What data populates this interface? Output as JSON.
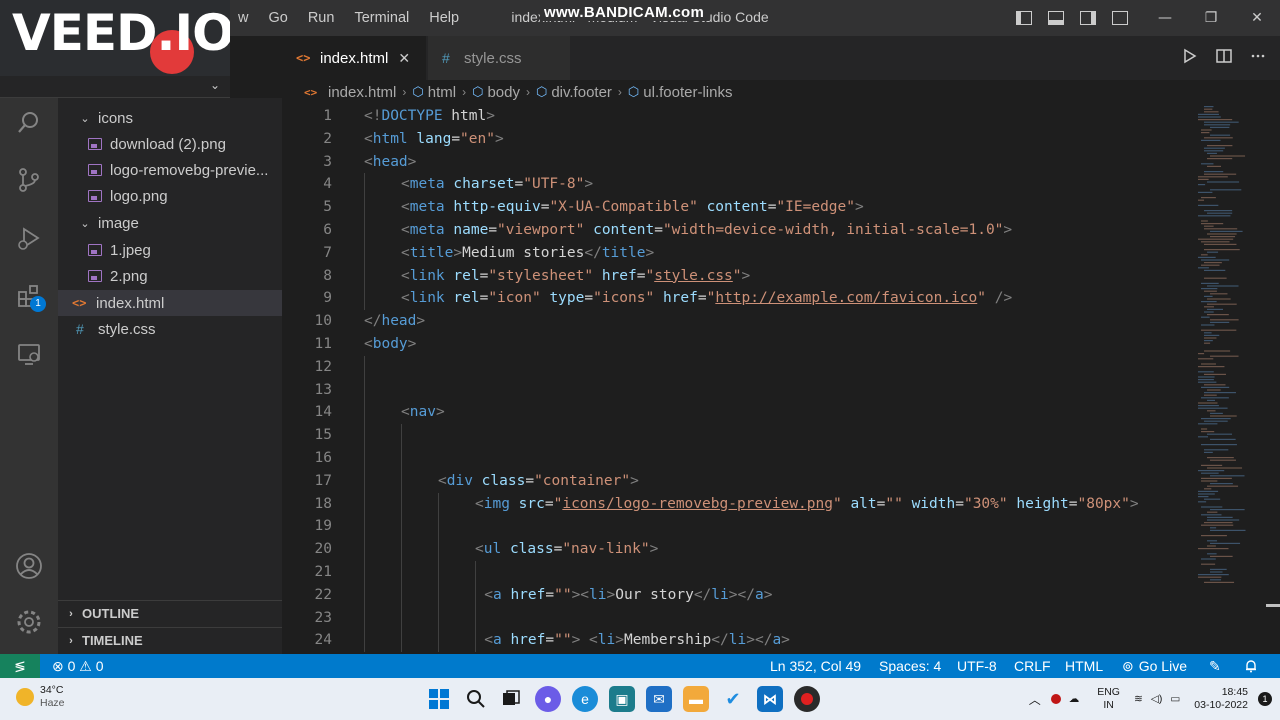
{
  "titlebar": {
    "menu": [
      "w",
      "Go",
      "Run",
      "Terminal",
      "Help"
    ],
    "window_title": "index.html - medium - Visual Studio Code",
    "overlay_watermark": "www.BANDICAM.com",
    "window_buttons": [
      "—",
      "❐",
      "✕"
    ]
  },
  "veed_overlay": {
    "logo": "VEED.IO",
    "chevron": "⌄"
  },
  "activity_bar": {
    "extensions_badge": "1"
  },
  "sidebar": {
    "items": [
      {
        "label": "icons",
        "type": "folder"
      },
      {
        "label": "download (2).png",
        "type": "image"
      },
      {
        "label": "logo-removebg-previe...",
        "type": "image"
      },
      {
        "label": "logo.png",
        "type": "image"
      },
      {
        "label": "image",
        "type": "folder"
      },
      {
        "label": "1.jpeg",
        "type": "image"
      },
      {
        "label": "2.png",
        "type": "image"
      },
      {
        "label": "index.html",
        "type": "html",
        "selected": true
      },
      {
        "label": "style.css",
        "type": "css"
      }
    ],
    "outline_label": "OUTLINE",
    "timeline_label": "TIMELINE"
  },
  "tabs": [
    {
      "label": "index.html",
      "active": true,
      "close": "✕"
    },
    {
      "label": "style.css",
      "active": false
    }
  ],
  "breadcrumb": [
    "index.html",
    "html",
    "body",
    "div.footer",
    "ul.footer-links"
  ],
  "editor": {
    "lines": [
      {
        "n": "1",
        "indent": 0,
        "tokens": [
          [
            "br",
            "<!"
          ],
          [
            "tag",
            "DOCTYPE"
          ],
          [
            "txt",
            " html"
          ],
          [
            "br",
            ">"
          ]
        ]
      },
      {
        "n": "2",
        "indent": 0,
        "tokens": [
          [
            "br",
            "<"
          ],
          [
            "tag",
            "html"
          ],
          [
            "txt",
            " "
          ],
          [
            "attr",
            "lang"
          ],
          [
            "txt",
            "="
          ],
          [
            "str",
            "\"en\""
          ],
          [
            "br",
            ">"
          ]
        ]
      },
      {
        "n": "3",
        "indent": 0,
        "tokens": [
          [
            "br",
            "<"
          ],
          [
            "tag",
            "head"
          ],
          [
            "br",
            ">"
          ]
        ]
      },
      {
        "n": "4",
        "indent": 1,
        "tokens": [
          [
            "br",
            "<"
          ],
          [
            "tag",
            "meta"
          ],
          [
            "txt",
            " "
          ],
          [
            "attr",
            "charset"
          ],
          [
            "txt",
            "="
          ],
          [
            "str",
            "\"UTF-8\""
          ],
          [
            "br",
            ">"
          ]
        ]
      },
      {
        "n": "5",
        "indent": 1,
        "tokens": [
          [
            "br",
            "<"
          ],
          [
            "tag",
            "meta"
          ],
          [
            "txt",
            " "
          ],
          [
            "attr",
            "http-equiv"
          ],
          [
            "txt",
            "="
          ],
          [
            "str",
            "\"X-UA-Compatible\""
          ],
          [
            "txt",
            " "
          ],
          [
            "attr",
            "content"
          ],
          [
            "txt",
            "="
          ],
          [
            "str",
            "\"IE=edge\""
          ],
          [
            "br",
            ">"
          ]
        ]
      },
      {
        "n": "6",
        "indent": 1,
        "tokens": [
          [
            "br",
            "<"
          ],
          [
            "tag",
            "meta"
          ],
          [
            "txt",
            " "
          ],
          [
            "attr",
            "name"
          ],
          [
            "txt",
            "="
          ],
          [
            "str",
            "\"viewport\""
          ],
          [
            "txt",
            " "
          ],
          [
            "attr",
            "content"
          ],
          [
            "txt",
            "="
          ],
          [
            "str",
            "\"width=device-width, initial-scale=1.0\""
          ],
          [
            "br",
            ">"
          ]
        ]
      },
      {
        "n": "7",
        "indent": 1,
        "tokens": [
          [
            "br",
            "<"
          ],
          [
            "tag",
            "title"
          ],
          [
            "br",
            ">"
          ],
          [
            "txt",
            "Medium stories"
          ],
          [
            "br",
            "</"
          ],
          [
            "tag",
            "title"
          ],
          [
            "br",
            ">"
          ]
        ]
      },
      {
        "n": "8",
        "indent": 1,
        "tokens": [
          [
            "br",
            "<"
          ],
          [
            "tag",
            "link"
          ],
          [
            "txt",
            " "
          ],
          [
            "attr",
            "rel"
          ],
          [
            "txt",
            "="
          ],
          [
            "str",
            "\"stylesheet\""
          ],
          [
            "txt",
            " "
          ],
          [
            "attr",
            "href"
          ],
          [
            "txt",
            "="
          ],
          [
            "str",
            "\""
          ],
          [
            "link",
            "style.css"
          ],
          [
            "str",
            "\""
          ],
          [
            "br",
            ">"
          ]
        ]
      },
      {
        "n": "9",
        "indent": 1,
        "tokens": [
          [
            "br",
            "<"
          ],
          [
            "tag",
            "link"
          ],
          [
            "txt",
            " "
          ],
          [
            "attr",
            "rel"
          ],
          [
            "txt",
            "="
          ],
          [
            "str",
            "\"icon\""
          ],
          [
            "txt",
            " "
          ],
          [
            "attr",
            "type"
          ],
          [
            "txt",
            "="
          ],
          [
            "str",
            "\"icons\""
          ],
          [
            "txt",
            " "
          ],
          [
            "attr",
            "href"
          ],
          [
            "txt",
            "="
          ],
          [
            "str",
            "\""
          ],
          [
            "link",
            "http://example.com/favicon.ico"
          ],
          [
            "str",
            "\""
          ],
          [
            "txt",
            " "
          ],
          [
            "br",
            "/>"
          ]
        ]
      },
      {
        "n": "10",
        "indent": 0,
        "tokens": [
          [
            "br",
            "</"
          ],
          [
            "tag",
            "head"
          ],
          [
            "br",
            ">"
          ]
        ]
      },
      {
        "n": "11",
        "indent": 0,
        "tokens": [
          [
            "br",
            "<"
          ],
          [
            "tag",
            "body"
          ],
          [
            "br",
            ">"
          ]
        ]
      },
      {
        "n": "12",
        "indent": 0,
        "tokens": []
      },
      {
        "n": "13",
        "indent": 0,
        "tokens": []
      },
      {
        "n": "14",
        "indent": 1,
        "tokens": [
          [
            "br",
            "<"
          ],
          [
            "tag",
            "nav"
          ],
          [
            "br",
            ">"
          ]
        ]
      },
      {
        "n": "15",
        "indent": 0,
        "tokens": []
      },
      {
        "n": "16",
        "indent": 0,
        "tokens": []
      },
      {
        "n": "17",
        "indent": 2,
        "tokens": [
          [
            "br",
            "<"
          ],
          [
            "tag",
            "div"
          ],
          [
            "txt",
            " "
          ],
          [
            "attr",
            "class"
          ],
          [
            "txt",
            "="
          ],
          [
            "str",
            "\"container\""
          ],
          [
            "br",
            ">"
          ]
        ]
      },
      {
        "n": "18",
        "indent": 3,
        "tokens": [
          [
            "br",
            "<"
          ],
          [
            "tag",
            "img"
          ],
          [
            "txt",
            " "
          ],
          [
            "attr",
            "src"
          ],
          [
            "txt",
            "="
          ],
          [
            "str",
            "\""
          ],
          [
            "link",
            "icons/logo-removebg-preview.png"
          ],
          [
            "str",
            "\""
          ],
          [
            "txt",
            " "
          ],
          [
            "attr",
            "alt"
          ],
          [
            "txt",
            "="
          ],
          [
            "str",
            "\"\""
          ],
          [
            "txt",
            " "
          ],
          [
            "attr",
            "width"
          ],
          [
            "txt",
            "="
          ],
          [
            "str",
            "\"30%\""
          ],
          [
            "txt",
            " "
          ],
          [
            "attr",
            "height"
          ],
          [
            "txt",
            "="
          ],
          [
            "str",
            "\"80px\""
          ],
          [
            "br",
            ">"
          ]
        ]
      },
      {
        "n": "19",
        "indent": 0,
        "tokens": []
      },
      {
        "n": "20",
        "indent": 3,
        "tokens": [
          [
            "br",
            "<"
          ],
          [
            "tag",
            "ul"
          ],
          [
            "txt",
            " "
          ],
          [
            "attr",
            "class"
          ],
          [
            "txt",
            "="
          ],
          [
            "str",
            "\"nav-link\""
          ],
          [
            "br",
            ">"
          ]
        ]
      },
      {
        "n": "21",
        "indent": 0,
        "tokens": []
      },
      {
        "n": "22",
        "indent": 3.25,
        "tokens": [
          [
            "br",
            "<"
          ],
          [
            "tag",
            "a"
          ],
          [
            "txt",
            " "
          ],
          [
            "attr",
            "href"
          ],
          [
            "txt",
            "="
          ],
          [
            "str",
            "\"\""
          ],
          [
            "br",
            "><"
          ],
          [
            "tag",
            "li"
          ],
          [
            "br",
            ">"
          ],
          [
            "txt",
            "Our story"
          ],
          [
            "br",
            "</"
          ],
          [
            "tag",
            "li"
          ],
          [
            "br",
            "></"
          ],
          [
            "tag",
            "a"
          ],
          [
            "br",
            ">"
          ]
        ]
      },
      {
        "n": "23",
        "indent": 0,
        "tokens": []
      },
      {
        "n": "24",
        "indent": 3.25,
        "tokens": [
          [
            "br",
            "<"
          ],
          [
            "tag",
            "a"
          ],
          [
            "txt",
            " "
          ],
          [
            "attr",
            "href"
          ],
          [
            "txt",
            "="
          ],
          [
            "str",
            "\"\""
          ],
          [
            "br",
            ">"
          ],
          [
            "txt",
            " "
          ],
          [
            "br",
            "<"
          ],
          [
            "tag",
            "li"
          ],
          [
            "br",
            ">"
          ],
          [
            "txt",
            "Membership"
          ],
          [
            "br",
            "</"
          ],
          [
            "tag",
            "li"
          ],
          [
            "br",
            "></"
          ],
          [
            "tag",
            "a"
          ],
          [
            "br",
            ">"
          ]
        ]
      }
    ]
  },
  "statusbar": {
    "problems": "⊗ 0 ⚠ 0",
    "position": "Ln 352, Col 49",
    "spaces": "Spaces: 4",
    "encoding": "UTF-8",
    "eol": "CRLF",
    "language": "HTML",
    "golive": "Go Live"
  },
  "taskbar": {
    "temperature": "34°C",
    "weather": "Haze",
    "lang_top": "ENG",
    "lang_bottom": "IN",
    "time": "18:45",
    "date": "03-10-2022"
  },
  "colors": {
    "statusbar": "#007acc",
    "remote": "#16825d",
    "activity_bar": "#333333",
    "sidebar": "#252526",
    "editor": "#1e1e1e"
  }
}
